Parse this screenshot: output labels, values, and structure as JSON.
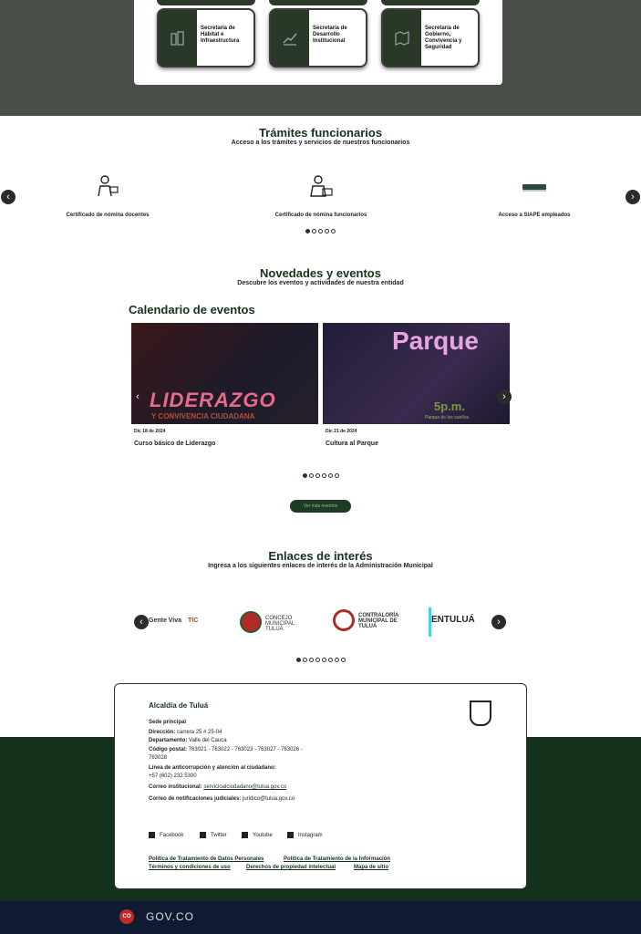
{
  "secretarias": [
    {
      "label": "Secretaría de Hábitat e Infraestructura",
      "icon": "building-icon"
    },
    {
      "label": "Secretaría de Desarrollo Institucional",
      "icon": "growth-chart-icon"
    },
    {
      "label": "Secretaría de Gobierno, Convivencia y Seguridad",
      "icon": "map-icon"
    }
  ],
  "tramites": {
    "title": "Trámites funcionarios",
    "subtitle": "Acceso a los trámites y servicios de nuestros funcionarios",
    "items": [
      {
        "label": "Certificado de nómina docentes",
        "icon": "teacher-icon"
      },
      {
        "label": "Certificado de nómina funcionarios",
        "icon": "employee-icon"
      },
      {
        "label": "Acceso a SIAPE empleados",
        "icon": "siape-logo"
      }
    ],
    "prev": "‹",
    "next": "›"
  },
  "novedades": {
    "title": "Novedades y eventos",
    "subtitle": "Descubre los eventos y actividades de nuestra entidad",
    "calendar_title": "Calendario de eventos",
    "events": [
      {
        "date": "Dic 18 de 2024",
        "name": "Curso básico de Liderazgo",
        "image_title": "LIDERAZGO",
        "image_subtitle": "Y CONVIVENCIA CIUDADANA"
      },
      {
        "date": "Dic 21 de 2024",
        "name": "Cultura al Parque",
        "image_title": "Parque",
        "image_time": "5p.m.",
        "image_place": "Parque de los sueños"
      }
    ],
    "more_button": "Ver más eventos"
  },
  "enlaces": {
    "title": "Enlaces de interés",
    "subtitle": "Ingresa a los siguientes enlaces de interés de la Administración Municipal",
    "logos": [
      "Gente Viva",
      "TIC",
      "CONCEJO MUNICIPAL TULUÁ",
      "CONTRALORÍA MUNICIPAL DE TULUÁ",
      "ENTULUÁ"
    ]
  },
  "footer": {
    "entity": "Alcaldía de Tuluá",
    "sede": "Sede principal",
    "direccion_label": "Dirección:",
    "direccion": "carrera 25 # 25-04",
    "depto_label": "Departamento:",
    "depto": "Valle del Cauca",
    "postal_label": "Código postal:",
    "postal": "763021 - 763022 - 763023 - 763027 - 763026 - 763028",
    "linea_label": "Línea de anticorrupción y atención al ciudadano:",
    "linea": "+57 (602) 232 5300",
    "correo_label": "Correo institucional:",
    "correo": "servicioalciudadano@tulua.gov.co",
    "notif_label": "Correo de notificaciones judiciales:",
    "notif": "juridico@tulua.gov.co",
    "social": [
      "Facebook",
      "Twitter",
      "Youtube",
      "Instagram"
    ],
    "links": [
      "Política de Tratamiento de Datos Personales",
      "Política de Tratamiento de la Información",
      "Términos y condiciones de uso",
      "Derechos de propiedad intelectual",
      "Mapa de sitio"
    ]
  },
  "govco": {
    "co": "CO",
    "brand": "GOV.CO"
  },
  "colors": {
    "brand_green": "#14321c",
    "band_gray": "#4b4f4a",
    "govco_blue": "#101a33"
  }
}
